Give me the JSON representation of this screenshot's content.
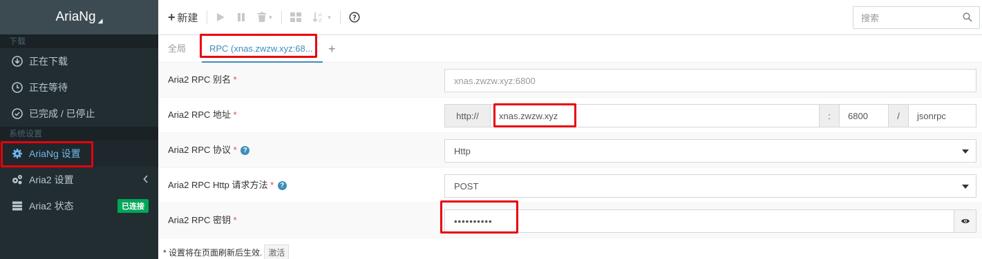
{
  "sidebar": {
    "brand": "AriaNg",
    "sections": {
      "download": "下载",
      "settings": "系统设置"
    },
    "items": {
      "downloading": "正在下载",
      "waiting": "正在等待",
      "stopped": "已完成 / 已停止",
      "ariang_settings": "AriaNg 设置",
      "aria2_settings": "Aria2 设置",
      "aria2_status": "Aria2 状态"
    },
    "status_badge": "已连接"
  },
  "toolbar": {
    "new_label": "新建",
    "search_placeholder": "搜索"
  },
  "tabs": {
    "global": "全局",
    "rpc": "RPC (xnas.zwzw.xyz:68..."
  },
  "form": {
    "alias": {
      "label": "Aria2 RPC 别名",
      "placeholder": "xnas.zwzw.xyz:6800"
    },
    "address": {
      "label": "Aria2 RPC 地址",
      "protocol_prefix": "http://",
      "host": "xnas.zwzw.xyz",
      "colon": ":",
      "port": "6800",
      "slash": "/",
      "path": "jsonrpc"
    },
    "protocol": {
      "label": "Aria2 RPC 协议",
      "value": "Http"
    },
    "method": {
      "label": "Aria2 RPC Http 请求方法",
      "value": "POST"
    },
    "secret": {
      "label": "Aria2 RPC 密钥",
      "value": "••••••••••"
    }
  },
  "footer": {
    "note": "* 设置将在页面刷新后生效.",
    "activate_label": "激活"
  },
  "colors": {
    "sidebar_bg": "#222d32",
    "accent": "#3c8dbc",
    "badge_green": "#00a65a",
    "annotation_red": "#e8000b"
  }
}
